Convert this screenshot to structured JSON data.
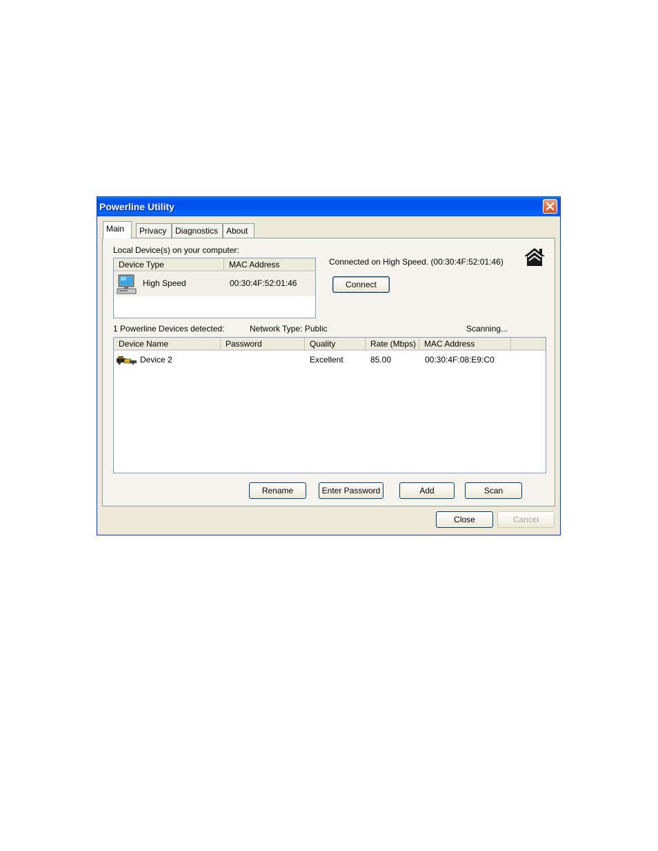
{
  "window": {
    "title": "Powerline Utility"
  },
  "tabs": [
    {
      "label": "Main",
      "active": true
    },
    {
      "label": "Privacy"
    },
    {
      "label": "Diagnostics"
    },
    {
      "label": "About"
    }
  ],
  "local": {
    "label": "Local Device(s) on your computer:",
    "columns": [
      "Device Type",
      "MAC Address"
    ],
    "rows": [
      {
        "type": "High Speed",
        "mac": "00:30:4F:52:01:46",
        "icon": "computer-icon"
      }
    ],
    "connected_text": "Connected on  High Speed. (00:30:4F:52:01:46)",
    "connect_label": "Connect"
  },
  "remote": {
    "detected_text": "1 Powerline Devices detected:",
    "network_type": "Network Type: Public",
    "scanning": "Scanning...",
    "columns": [
      "Device Name",
      "Password",
      "Quality",
      "Rate (Mbps)",
      "MAC Address"
    ],
    "rows": [
      {
        "name": "Device 2",
        "password": "",
        "quality": "Excellent",
        "rate": "85.00",
        "mac": "00:30:4F:08:E9:C0",
        "icon": "powerline-adapter-icon"
      }
    ]
  },
  "actions": {
    "rename": "Rename",
    "enter_password": "Enter Password",
    "add": "Add",
    "scan": "Scan"
  },
  "footer": {
    "close": "Close",
    "cancel": "Cancel"
  },
  "colors": {
    "titlebar": "#0054e3",
    "dialog_bg": "#ece9d8",
    "close_button": "#d34f22"
  }
}
